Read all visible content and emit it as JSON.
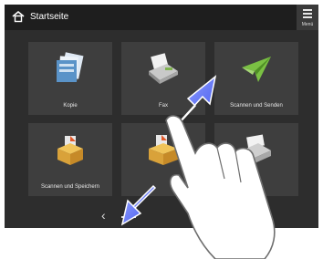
{
  "header": {
    "title": "Startseite",
    "menu_label": "Menü"
  },
  "tiles": [
    {
      "label": "Kopie",
      "icon": "copy-icon"
    },
    {
      "label": "Fax",
      "icon": "fax-icon"
    },
    {
      "label": "Scannen und Senden",
      "icon": "scan-send-icon"
    },
    {
      "label": "Scannen und Speichern",
      "icon": "scan-store-icon"
    },
    {
      "label": "",
      "icon": "access-files-icon"
    },
    {
      "label": "",
      "icon": "printer-icon"
    }
  ],
  "pager": {
    "prev_icon": "chevron-left-icon"
  },
  "gesture": {
    "type": "pinch-zoom",
    "arrows": "diagonal-double-arrow-icon",
    "hand": "hand-icon"
  },
  "colors": {
    "screen_bg": "#2d2d2d",
    "header_bg": "#1e1e1e",
    "tile_bg": "#3e3e3e",
    "arrow_blue": "#4a5ef0"
  }
}
